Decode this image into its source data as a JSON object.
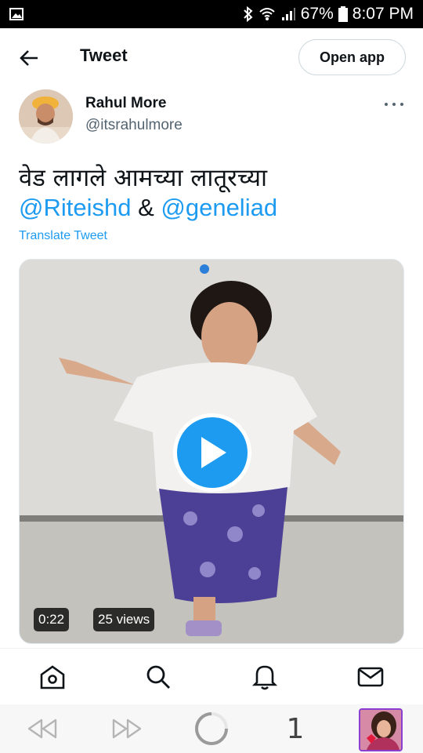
{
  "status_bar": {
    "battery_percent": "67%",
    "time": "8:07 PM"
  },
  "header": {
    "title": "Tweet",
    "open_app_label": "Open app"
  },
  "author": {
    "name": "Rahul More",
    "handle": "@itsrahulmore"
  },
  "tweet": {
    "text_line1": "वेड लागले आमच्या लातूरच्या",
    "mention1": "@Riteishd",
    "connector": " & ",
    "mention2": "@geneliad",
    "translate_label": "Translate Tweet"
  },
  "media": {
    "duration": "0:22",
    "views": "25 views"
  },
  "browser": {
    "tab_count": "1"
  },
  "colors": {
    "accent": "#1d9bf0",
    "text_primary": "#0f1419",
    "text_secondary": "#536471"
  }
}
